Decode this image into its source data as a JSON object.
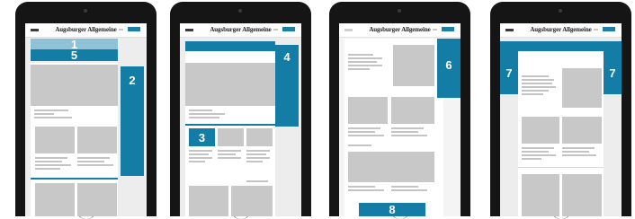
{
  "brand": "Augsburger Allgemeine",
  "ad_color": "#137da5",
  "tablets": [
    {
      "labels": [
        "1",
        "5",
        "2"
      ]
    },
    {
      "labels": [
        "4",
        "3"
      ]
    },
    {
      "labels": [
        "6",
        "8"
      ]
    },
    {
      "labels": [
        "7",
        "7"
      ]
    }
  ]
}
